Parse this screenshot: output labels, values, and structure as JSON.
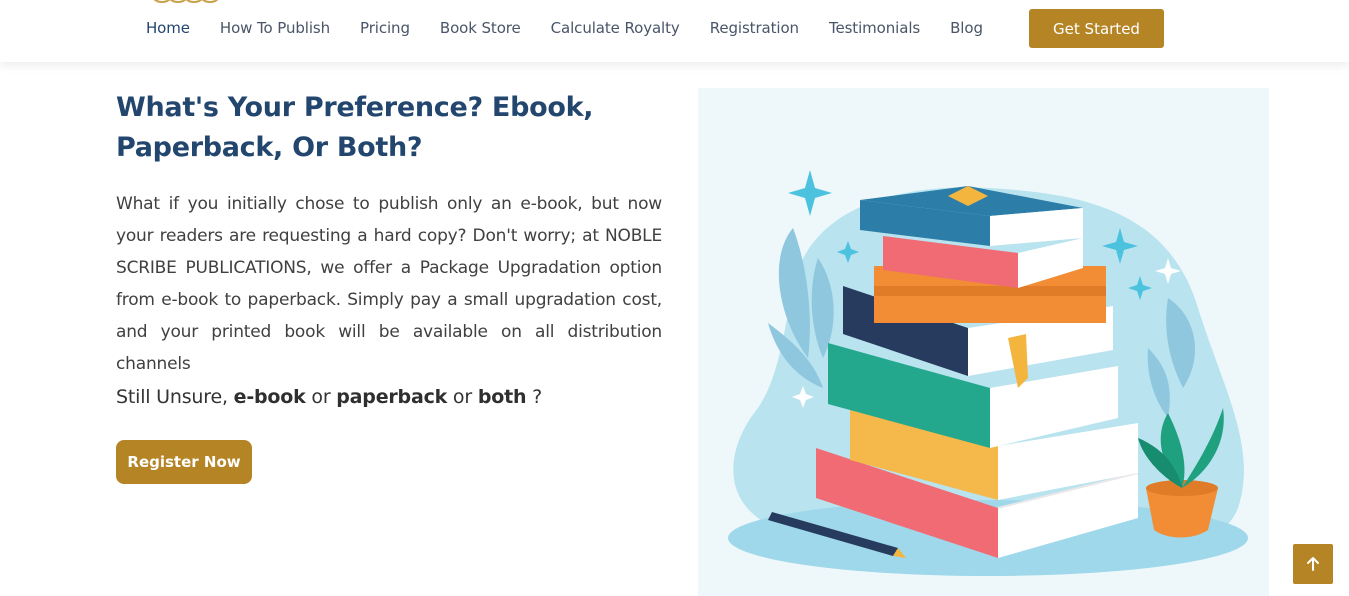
{
  "nav": {
    "items": [
      {
        "label": "Home",
        "active": true
      },
      {
        "label": "How To Publish"
      },
      {
        "label": "Pricing"
      },
      {
        "label": "Book Store"
      },
      {
        "label": "Calculate Royalty"
      },
      {
        "label": "Registration"
      },
      {
        "label": "Testimonials"
      },
      {
        "label": "Blog"
      }
    ],
    "cta_label": "Get Started"
  },
  "section": {
    "title": "What's Your Preference? Ebook, Paperback, Or Both?",
    "paragraph": "What if you initially chose to publish only an e-book, but now your readers are requesting a hard copy? Don't worry; at NOBLE SCRIBE PUBLICATIONS, we offer a Package Upgradation option from e-book to paperback. Simply pay a small upgradation cost, and your printed book will be available on all distribution channels",
    "unsure": {
      "prefix": "Still Unsure, ",
      "opt1": "e-book",
      "sep1": " or ",
      "opt2": "paperback",
      "sep2": " or ",
      "opt3": "both",
      "suffix": " ?"
    },
    "register_label": "Register Now"
  },
  "illustration": {
    "icon": "stacked-books-illustration"
  },
  "scroll_top": {
    "icon": "arrow-up-icon"
  },
  "colors": {
    "brand_gold": "#b58425",
    "heading_navy": "#22466e",
    "nav_text": "#4a5568",
    "illustration_bg": "#eef8fa"
  }
}
